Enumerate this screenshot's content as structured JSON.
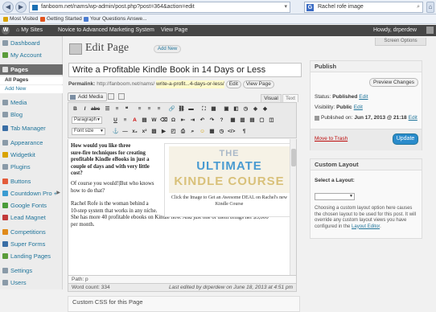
{
  "browser": {
    "url": "fanboom.net/nams/wp-admin/post.php?post=364&action=edit",
    "search": "Rachel rofe image",
    "search_icon": "G"
  },
  "bookmarks": [
    {
      "label": "Most Visited",
      "color": "#d9a300"
    },
    {
      "label": "Getting Started",
      "color": "#e2531d"
    },
    {
      "label": "Your Questions Answe...",
      "color": "#4a7bd1"
    }
  ],
  "adminbar": {
    "logo": "W",
    "my_sites": "My Sites",
    "site_name": "Novice to Advanced Marketing System",
    "view_page": "View Page",
    "howdy": "Howdy, drperdew"
  },
  "sidebar": {
    "items": [
      {
        "label": "Dashboard"
      },
      {
        "label": "My Account"
      },
      {
        "label": "Pages"
      },
      {
        "label": "Media"
      },
      {
        "label": "Blog"
      },
      {
        "label": "Tab Manager"
      },
      {
        "label": "Appearance"
      },
      {
        "label": "Widgetkit"
      },
      {
        "label": "Plugins"
      },
      {
        "label": "Buttons"
      },
      {
        "label": "Countdown Pro +"
      },
      {
        "label": "Google Fonts"
      },
      {
        "label": "Lead Magnet"
      },
      {
        "label": "Competitions"
      },
      {
        "label": "Super Forms"
      },
      {
        "label": "Landing Pages"
      },
      {
        "label": "Settings"
      },
      {
        "label": "Users"
      }
    ],
    "sub_all_pages": "All Pages",
    "sub_add_new": "Add New"
  },
  "header": {
    "screen_options": "Screen Options",
    "title": "Edit Page",
    "add_new": "Add New"
  },
  "post": {
    "title": "Write a Profitable Kindle Book in 14 Days or Less",
    "permalink_label": "Permalink:",
    "permalink_base": "http://fanboom.net/nams/",
    "permalink_slug": "write-a-profit...4-days-or-less/",
    "edit_btn": "Edit",
    "view_page_btn": "View Page"
  },
  "editor": {
    "add_media": "Add Media",
    "tab_visual": "Visual",
    "tab_text": "Text",
    "format_select": "Paragraph",
    "font_size_select": "Font size",
    "paragraph1": [
      "How would you like three",
      "sure-fire techniques for creating",
      "profitable Kindle eBooks in just a",
      "couple of days and with very little",
      "cost?"
    ],
    "paragraph2": [
      "Of course you would!|But who knows",
      "how to do that?"
    ],
    "paragraph3": [
      "Rachel Rofe is the woman behind a",
      "10-step system that works in any niche.",
      "She has more 40 profitable ebooks on Kindle now. And just one of them brings her $3,000",
      "per month."
    ],
    "ad": {
      "line1": "THE",
      "line2": "ULTIMATE",
      "line3": "KINDLE COURSE",
      "caption": "Click the Image to Get an Awesome DEAL on Rachel's new Kindle Course"
    },
    "path": "Path: p",
    "word_count": "Word count: 334",
    "last_edited": "Last edited by drperdew on June 18, 2013 at 4:51 pm"
  },
  "custom_css_title": "Custom CSS for this Page",
  "publish": {
    "title": "Publish",
    "preview": "Preview Changes",
    "status_label": "Status:",
    "status_value": "Published",
    "visibility_label": "Visibility:",
    "visibility_value": "Public",
    "published_on_label": "Published on:",
    "published_on_value": "Jun 17, 2013 @ 21:18",
    "edit": "Edit",
    "trash": "Move to Trash",
    "update": "Update"
  },
  "custom_layout": {
    "title": "Custom Layout",
    "select_label": "Select a Layout:",
    "help": "Choosing a custom layout option here causes the chosen layout to be used for this post. It will override any custom layout views you have configured in the",
    "help_link": "Layout Editor"
  }
}
